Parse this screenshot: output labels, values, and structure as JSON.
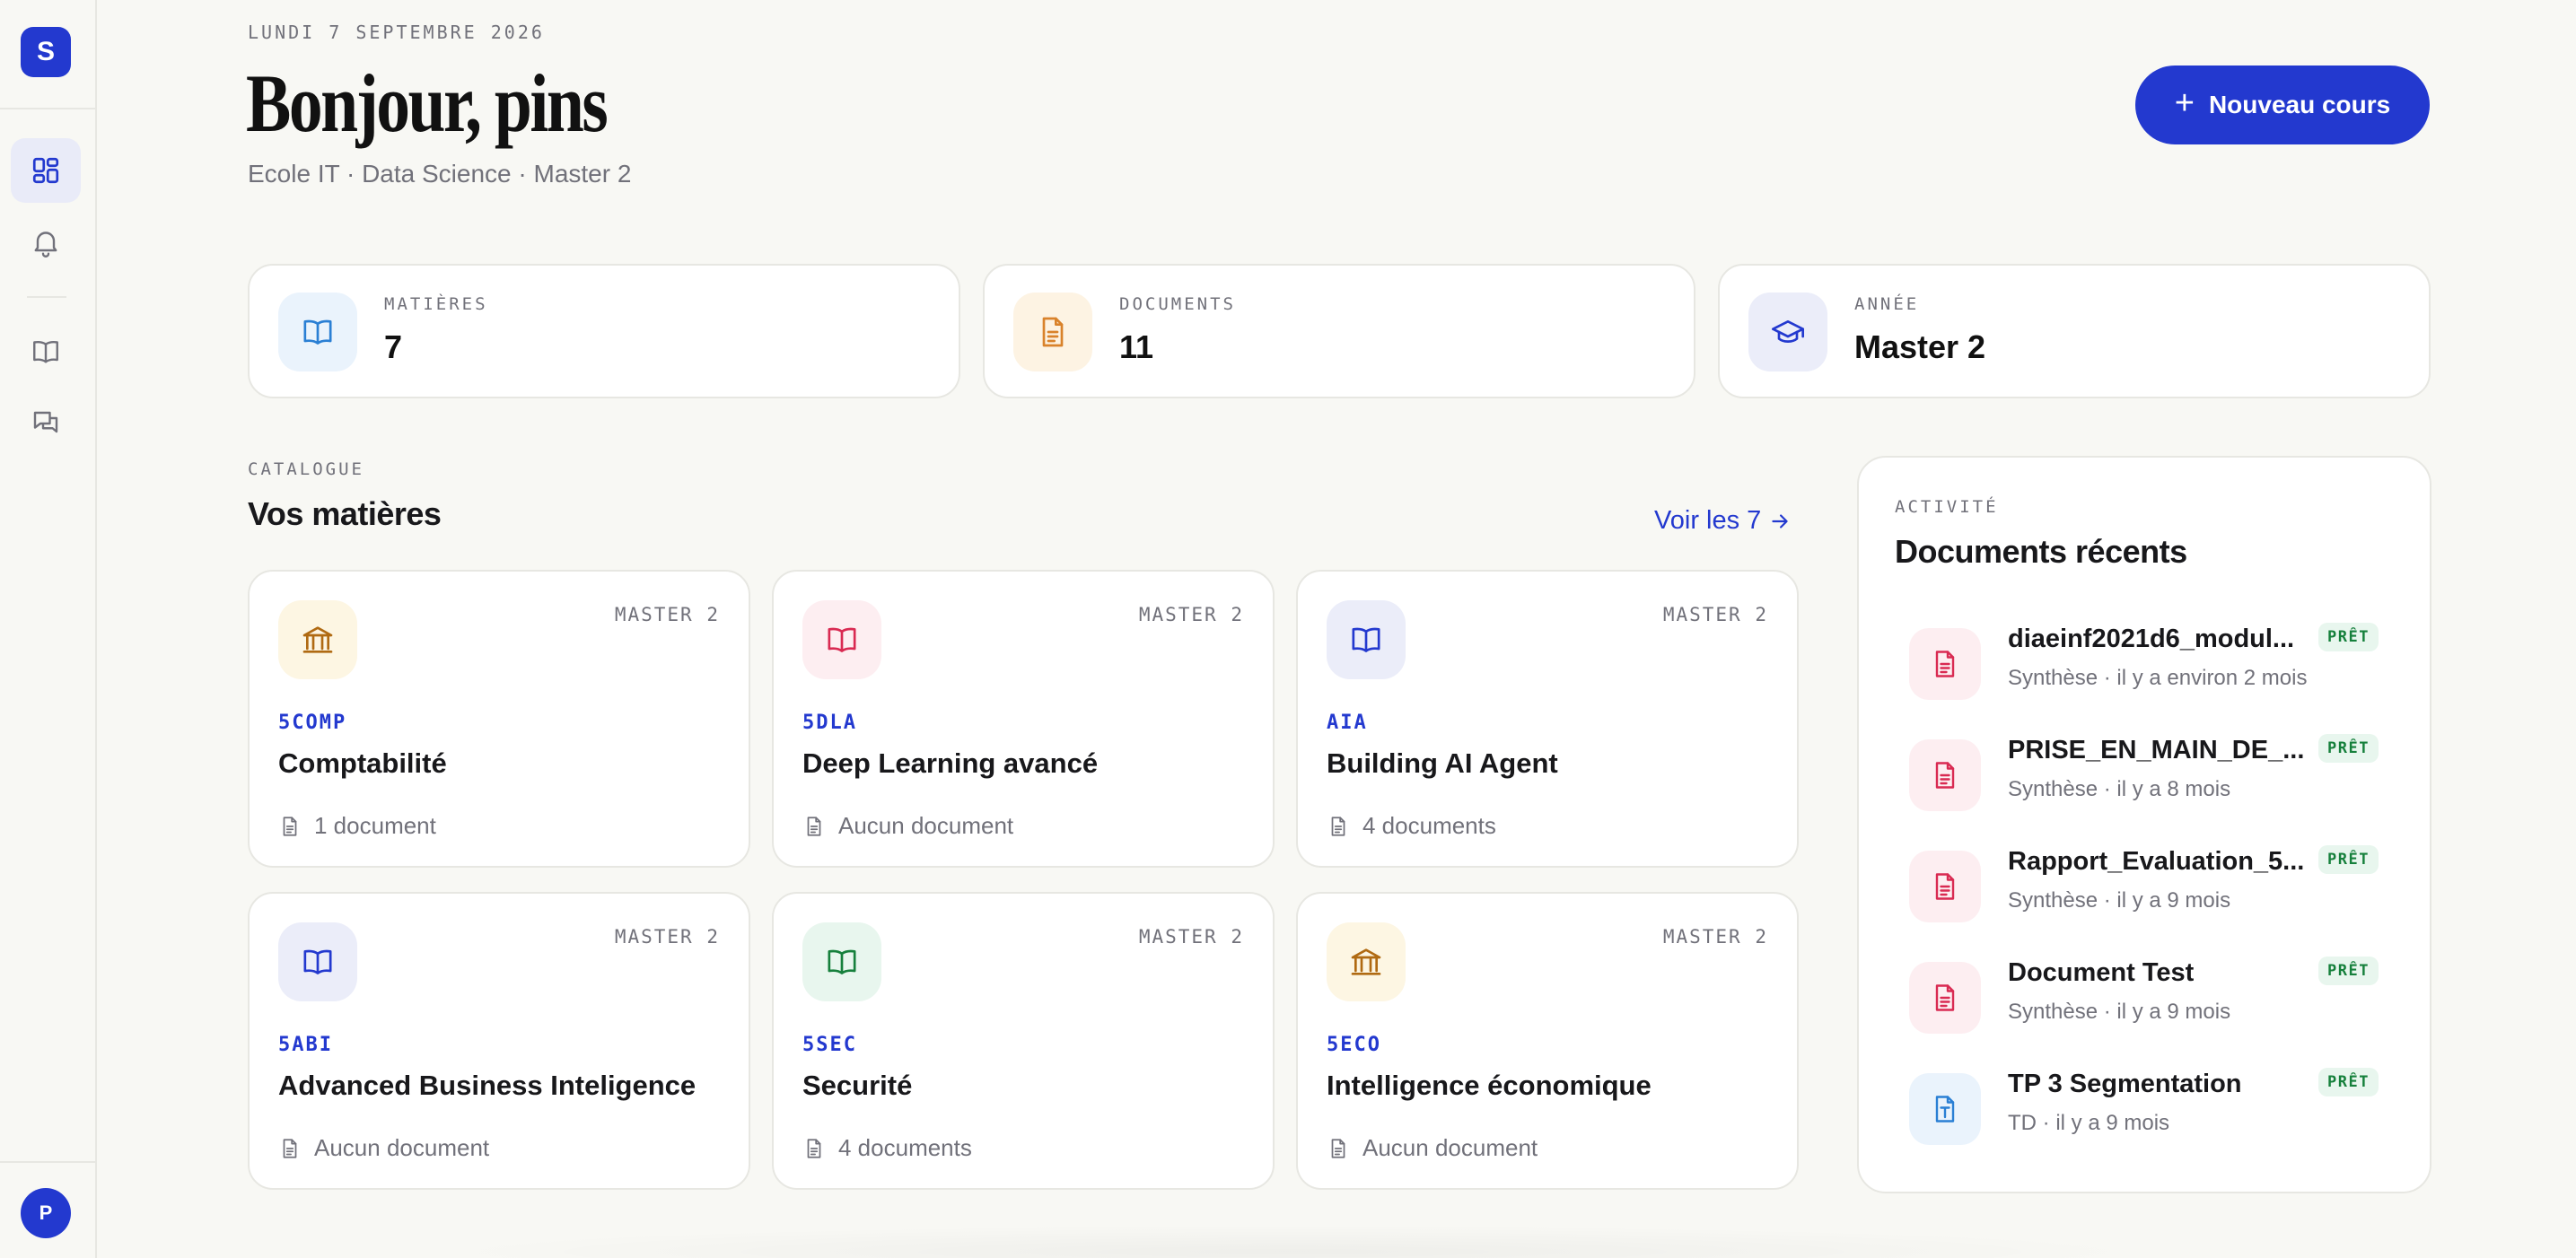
{
  "app": {
    "logo_letter": "S",
    "avatar_letter": "P"
  },
  "header": {
    "date": "LUNDI 7 SEPTEMBRE 2026",
    "greeting": "Bonjour, pins",
    "subtitle": "Ecole IT · Data Science · Master 2",
    "new_course_label": "Nouveau cours"
  },
  "stats": [
    {
      "label": "MATIÈRES",
      "value": "7",
      "icon": "book-icon",
      "color": "#2a7fd4",
      "bg": "#eaf3fc"
    },
    {
      "label": "DOCUMENTS",
      "value": "11",
      "icon": "document-icon",
      "color": "#d9822b",
      "bg": "#fdf3e3"
    },
    {
      "label": "ANNÉE",
      "value": "Master 2",
      "icon": "graduation-cap-icon",
      "color": "#2339cf",
      "bg": "#ebedf9"
    }
  ],
  "catalogue": {
    "label": "CATALOGUE",
    "title": "Vos matières",
    "see_all": "Voir les 7",
    "cards": [
      {
        "level": "MASTER 2",
        "code": "5COMP",
        "name": "Comptabilité",
        "docs": "1 document",
        "icon": "bank-icon",
        "color": "#b06a12",
        "bg": "#fdf6e3"
      },
      {
        "level": "MASTER 2",
        "code": "5DLA",
        "name": "Deep Learning avancé",
        "docs": "Aucun document",
        "icon": "book-icon",
        "color": "#d92a52",
        "bg": "#fdeef1"
      },
      {
        "level": "MASTER 2",
        "code": "AIA",
        "name": "Building AI Agent",
        "docs": "4 documents",
        "icon": "book-icon",
        "color": "#2339cf",
        "bg": "#ebedf9"
      },
      {
        "level": "MASTER 2",
        "code": "5ABI",
        "name": "Advanced Business Inteligence",
        "docs": "Aucun document",
        "icon": "book-icon",
        "color": "#2339cf",
        "bg": "#ebedf9"
      },
      {
        "level": "MASTER 2",
        "code": "5SEC",
        "name": "Securité",
        "docs": "4 documents",
        "icon": "book-icon",
        "color": "#16803c",
        "bg": "#e8f6ee"
      },
      {
        "level": "MASTER 2",
        "code": "5ECO",
        "name": "Intelligence économique",
        "docs": "Aucun document",
        "icon": "bank-icon",
        "color": "#b06a12",
        "bg": "#fdf6e3"
      }
    ]
  },
  "recent": {
    "label": "ACTIVITÉ",
    "title": "Documents récents",
    "items": [
      {
        "name": "diaeinf2021d6_modul...",
        "meta": "Synthèse · il y a environ 2 mois",
        "badge": "PRÊT",
        "icon": "document-icon",
        "color": "#d92a52",
        "bg": "#fdeef1"
      },
      {
        "name": "PRISE_EN_MAIN_DE_...",
        "meta": "Synthèse · il y a 8 mois",
        "badge": "PRÊT",
        "icon": "document-icon",
        "color": "#d92a52",
        "bg": "#fdeef1"
      },
      {
        "name": "Rapport_Evaluation_5...",
        "meta": "Synthèse · il y a 9 mois",
        "badge": "PRÊT",
        "icon": "document-icon",
        "color": "#d92a52",
        "bg": "#fdeef1"
      },
      {
        "name": "Document Test",
        "meta": "Synthèse · il y a 9 mois",
        "badge": "PRÊT",
        "icon": "document-icon",
        "color": "#d92a52",
        "bg": "#fdeef1"
      },
      {
        "name": "TP 3 Segmentation",
        "meta": "TD · il y a 9 mois",
        "badge": "PRÊT",
        "icon": "text-document-icon",
        "color": "#2a7fd4",
        "bg": "#eaf3fc"
      }
    ]
  }
}
